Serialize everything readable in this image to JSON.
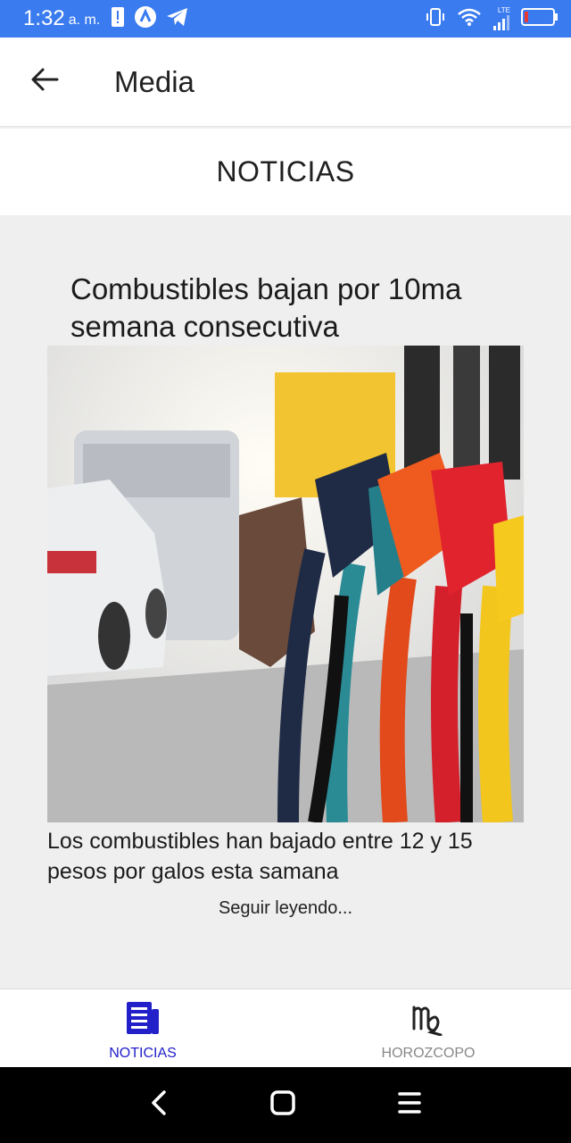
{
  "status_bar": {
    "time": "1:32",
    "ampm": "a. m.",
    "network_label": "LTE",
    "colors": {
      "background": "#3a7bf0",
      "battery_low": "#e53935"
    }
  },
  "app_bar": {
    "title": "Media",
    "back_icon": "arrow-left-icon"
  },
  "section": {
    "title": "NOTICIAS"
  },
  "article": {
    "title": "Combustibles bajan por 10ma semana consecutiva",
    "description": "Los combustibles han bajado entre 12 y 15 pesos por galos esta samana",
    "read_more": "Seguir leyendo..."
  },
  "bottom_nav": {
    "items": [
      {
        "label": "NOTICIAS",
        "icon": "newspaper-icon",
        "active": true
      },
      {
        "label": "HOROZCOPO",
        "icon": "virgo-icon",
        "active": false
      }
    ],
    "colors": {
      "active": "#2320c9",
      "inactive": "#888888"
    }
  }
}
